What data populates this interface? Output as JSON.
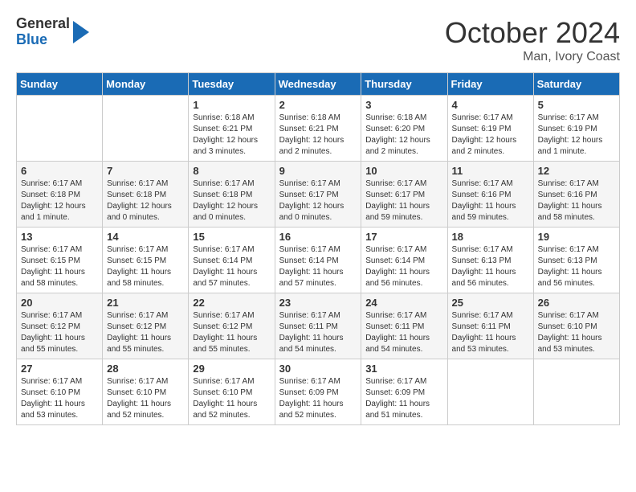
{
  "header": {
    "logo_general": "General",
    "logo_blue": "Blue",
    "month_title": "October 2024",
    "location": "Man, Ivory Coast"
  },
  "days_of_week": [
    "Sunday",
    "Monday",
    "Tuesday",
    "Wednesday",
    "Thursday",
    "Friday",
    "Saturday"
  ],
  "weeks": [
    [
      {
        "day": "",
        "info": ""
      },
      {
        "day": "",
        "info": ""
      },
      {
        "day": "1",
        "info": "Sunrise: 6:18 AM\nSunset: 6:21 PM\nDaylight: 12 hours and 3 minutes."
      },
      {
        "day": "2",
        "info": "Sunrise: 6:18 AM\nSunset: 6:21 PM\nDaylight: 12 hours and 2 minutes."
      },
      {
        "day": "3",
        "info": "Sunrise: 6:18 AM\nSunset: 6:20 PM\nDaylight: 12 hours and 2 minutes."
      },
      {
        "day": "4",
        "info": "Sunrise: 6:17 AM\nSunset: 6:19 PM\nDaylight: 12 hours and 2 minutes."
      },
      {
        "day": "5",
        "info": "Sunrise: 6:17 AM\nSunset: 6:19 PM\nDaylight: 12 hours and 1 minute."
      }
    ],
    [
      {
        "day": "6",
        "info": "Sunrise: 6:17 AM\nSunset: 6:18 PM\nDaylight: 12 hours and 1 minute."
      },
      {
        "day": "7",
        "info": "Sunrise: 6:17 AM\nSunset: 6:18 PM\nDaylight: 12 hours and 0 minutes."
      },
      {
        "day": "8",
        "info": "Sunrise: 6:17 AM\nSunset: 6:18 PM\nDaylight: 12 hours and 0 minutes."
      },
      {
        "day": "9",
        "info": "Sunrise: 6:17 AM\nSunset: 6:17 PM\nDaylight: 12 hours and 0 minutes."
      },
      {
        "day": "10",
        "info": "Sunrise: 6:17 AM\nSunset: 6:17 PM\nDaylight: 11 hours and 59 minutes."
      },
      {
        "day": "11",
        "info": "Sunrise: 6:17 AM\nSunset: 6:16 PM\nDaylight: 11 hours and 59 minutes."
      },
      {
        "day": "12",
        "info": "Sunrise: 6:17 AM\nSunset: 6:16 PM\nDaylight: 11 hours and 58 minutes."
      }
    ],
    [
      {
        "day": "13",
        "info": "Sunrise: 6:17 AM\nSunset: 6:15 PM\nDaylight: 11 hours and 58 minutes."
      },
      {
        "day": "14",
        "info": "Sunrise: 6:17 AM\nSunset: 6:15 PM\nDaylight: 11 hours and 58 minutes."
      },
      {
        "day": "15",
        "info": "Sunrise: 6:17 AM\nSunset: 6:14 PM\nDaylight: 11 hours and 57 minutes."
      },
      {
        "day": "16",
        "info": "Sunrise: 6:17 AM\nSunset: 6:14 PM\nDaylight: 11 hours and 57 minutes."
      },
      {
        "day": "17",
        "info": "Sunrise: 6:17 AM\nSunset: 6:14 PM\nDaylight: 11 hours and 56 minutes."
      },
      {
        "day": "18",
        "info": "Sunrise: 6:17 AM\nSunset: 6:13 PM\nDaylight: 11 hours and 56 minutes."
      },
      {
        "day": "19",
        "info": "Sunrise: 6:17 AM\nSunset: 6:13 PM\nDaylight: 11 hours and 56 minutes."
      }
    ],
    [
      {
        "day": "20",
        "info": "Sunrise: 6:17 AM\nSunset: 6:12 PM\nDaylight: 11 hours and 55 minutes."
      },
      {
        "day": "21",
        "info": "Sunrise: 6:17 AM\nSunset: 6:12 PM\nDaylight: 11 hours and 55 minutes."
      },
      {
        "day": "22",
        "info": "Sunrise: 6:17 AM\nSunset: 6:12 PM\nDaylight: 11 hours and 55 minutes."
      },
      {
        "day": "23",
        "info": "Sunrise: 6:17 AM\nSunset: 6:11 PM\nDaylight: 11 hours and 54 minutes."
      },
      {
        "day": "24",
        "info": "Sunrise: 6:17 AM\nSunset: 6:11 PM\nDaylight: 11 hours and 54 minutes."
      },
      {
        "day": "25",
        "info": "Sunrise: 6:17 AM\nSunset: 6:11 PM\nDaylight: 11 hours and 53 minutes."
      },
      {
        "day": "26",
        "info": "Sunrise: 6:17 AM\nSunset: 6:10 PM\nDaylight: 11 hours and 53 minutes."
      }
    ],
    [
      {
        "day": "27",
        "info": "Sunrise: 6:17 AM\nSunset: 6:10 PM\nDaylight: 11 hours and 53 minutes."
      },
      {
        "day": "28",
        "info": "Sunrise: 6:17 AM\nSunset: 6:10 PM\nDaylight: 11 hours and 52 minutes."
      },
      {
        "day": "29",
        "info": "Sunrise: 6:17 AM\nSunset: 6:10 PM\nDaylight: 11 hours and 52 minutes."
      },
      {
        "day": "30",
        "info": "Sunrise: 6:17 AM\nSunset: 6:09 PM\nDaylight: 11 hours and 52 minutes."
      },
      {
        "day": "31",
        "info": "Sunrise: 6:17 AM\nSunset: 6:09 PM\nDaylight: 11 hours and 51 minutes."
      },
      {
        "day": "",
        "info": ""
      },
      {
        "day": "",
        "info": ""
      }
    ]
  ]
}
